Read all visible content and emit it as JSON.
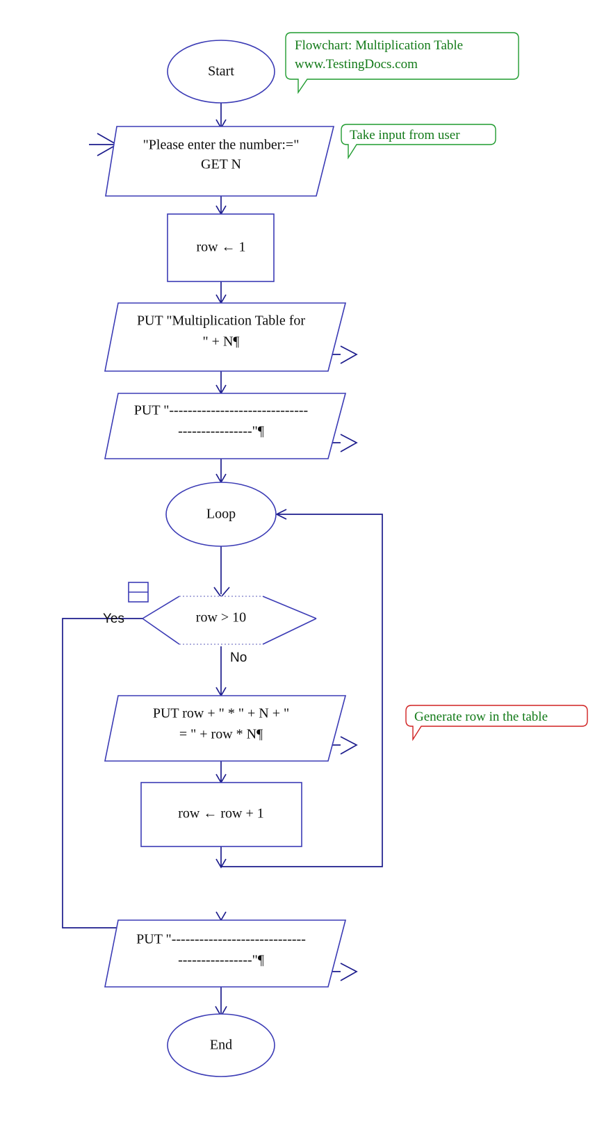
{
  "diagram": {
    "title": "Flowchart: Multiplication Table",
    "colors": {
      "shape_stroke": "#3b3bb5",
      "connector": "#1c1c8c",
      "callout_green": "#1f9b2f",
      "callout_red": "#d02020",
      "callout_text": "#127a18",
      "node_text": "#0d0d0d",
      "background": "#ffffff"
    }
  },
  "nodes": {
    "start": {
      "label": "Start",
      "type": "terminator"
    },
    "input": {
      "line1": "\"Please enter the number:=\"",
      "line2": "GET N",
      "type": "input"
    },
    "init_row": {
      "label": "row ← 1",
      "type": "process"
    },
    "put_header": {
      "line1": "PUT \"Multiplication Table for",
      "line2": "\" + N¶",
      "type": "output"
    },
    "put_sep_top": {
      "line1": "PUT \"------------------------------",
      "line2": "----------------\"¶",
      "type": "output"
    },
    "loop": {
      "label": "Loop",
      "type": "loop"
    },
    "decision": {
      "label": "row > 10",
      "type": "decision",
      "yes_label": "Yes",
      "no_label": "No"
    },
    "put_row": {
      "line1": "PUT row  +  \"  *  \"  +  N  +  \"",
      "line2": "=  \"  +  row * N¶",
      "type": "output"
    },
    "increment": {
      "label": "row ← row  +  1",
      "type": "process"
    },
    "put_sep_bottom": {
      "line1": "PUT \"-----------------------------",
      "line2": "----------------\"¶",
      "type": "output"
    },
    "end": {
      "label": "End",
      "type": "terminator"
    }
  },
  "callouts": {
    "title_note": {
      "line1": "Flowchart: Multiplication Table",
      "line2": "www.TestingDocs.com",
      "border": "green"
    },
    "input_note": {
      "line1": "Take input from user",
      "border": "green"
    },
    "row_note": {
      "line1": "Generate row in the table",
      "border": "red"
    }
  }
}
